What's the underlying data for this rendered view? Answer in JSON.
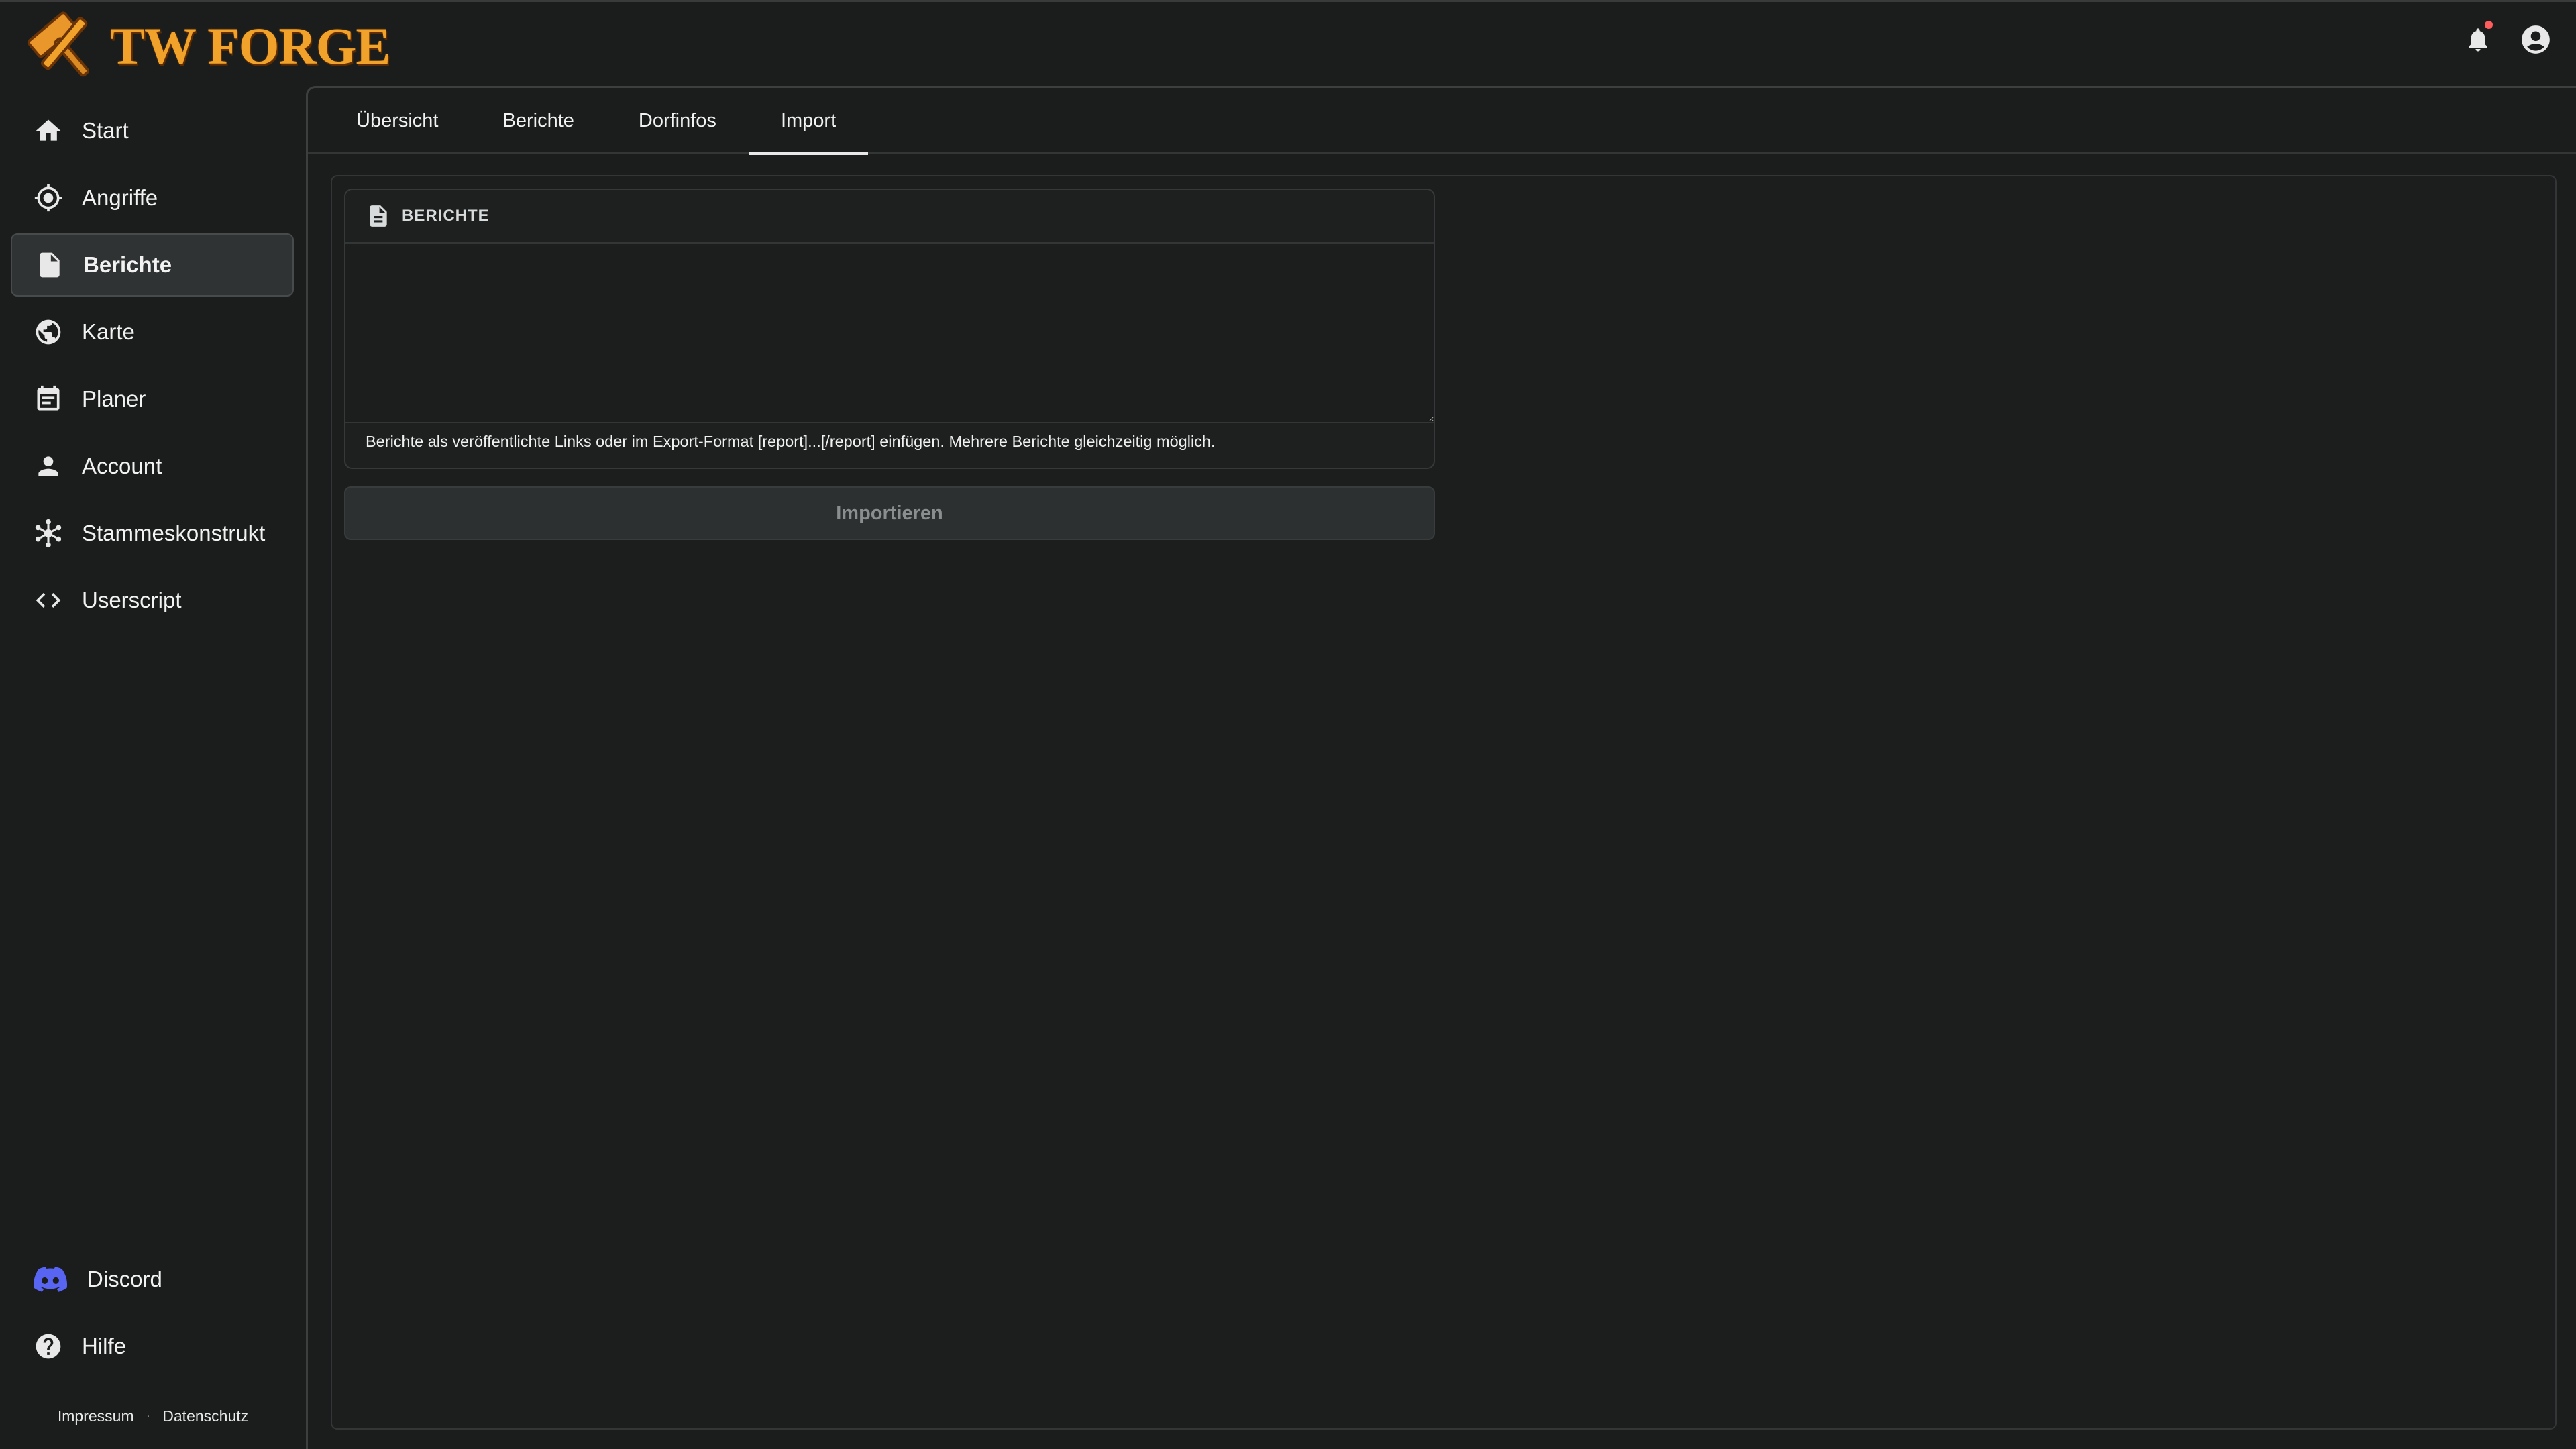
{
  "app": {
    "logo_text": "TW FORGE"
  },
  "sidebar": {
    "items": [
      {
        "label": "Start",
        "icon": "home-icon"
      },
      {
        "label": "Angriffe",
        "icon": "crosshair-icon"
      },
      {
        "label": "Berichte",
        "icon": "report-icon",
        "active": true
      },
      {
        "label": "Karte",
        "icon": "globe-icon"
      },
      {
        "label": "Planer",
        "icon": "calendar-icon"
      },
      {
        "label": "Account",
        "icon": "person-icon"
      },
      {
        "label": "Stammeskonstrukt",
        "icon": "hub-icon"
      },
      {
        "label": "Userscript",
        "icon": "code-icon"
      }
    ],
    "bottom_items": [
      {
        "label": "Discord",
        "icon": "discord-icon"
      },
      {
        "label": "Hilfe",
        "icon": "help-icon"
      }
    ],
    "footer": {
      "impressum": "Impressum",
      "separator": "·",
      "datenschutz": "Datenschutz"
    }
  },
  "tabs": [
    {
      "label": "Übersicht"
    },
    {
      "label": "Berichte"
    },
    {
      "label": "Dorfinfos"
    },
    {
      "label": "Import",
      "active": true
    }
  ],
  "import_card": {
    "title": "BERICHTE",
    "textarea_value": "",
    "hint": "Berichte als veröffentlichte Links oder im Export-Format [report]...[/report] einfügen. Mehrere Berichte gleichzeitig möglich."
  },
  "import_button": {
    "label": "Importieren",
    "disabled": true
  },
  "colors": {
    "background": "#1b1d1d",
    "logo_orange": "#f0a22a",
    "discord_blurple": "#5865f2",
    "notification_dot": "#ff5d5d"
  }
}
